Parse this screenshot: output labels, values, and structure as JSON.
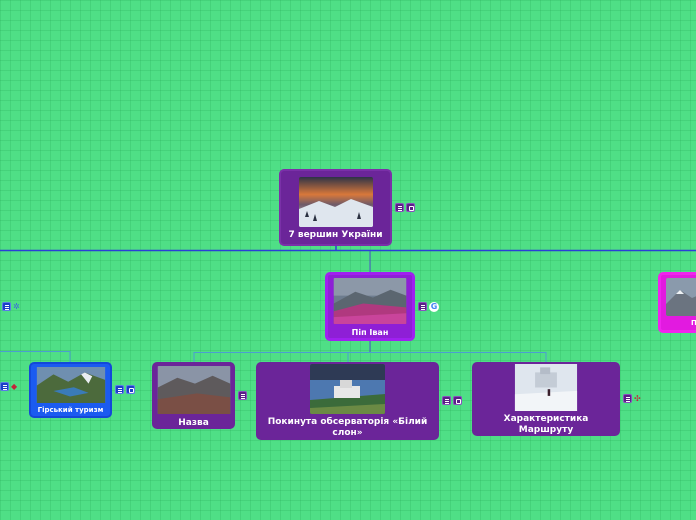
{
  "nodes": {
    "root": {
      "label": "7 вершин України"
    },
    "pip_ivan": {
      "label": "Піп Іван"
    },
    "girskyi_turyzm": {
      "label": "Гірський туризм"
    },
    "nazva": {
      "label": "Назва"
    },
    "observatoriya": {
      "label": "Покинута обсерваторія «Білий слон»"
    },
    "kharakterystyka": {
      "label": "Характеристика Маршруту"
    },
    "right_partial": {
      "label": "П"
    }
  },
  "colors": {
    "background": "#4fdf86",
    "link_main": "#2a3fd8",
    "node_purple": "#6b2599",
    "node_violet": "#8e1fd6",
    "node_blue": "#1b5bf0",
    "node_pink": "#e21ae0"
  },
  "icons": [
    "notes-icon",
    "link-icon",
    "google-icon",
    "pin-icon",
    "globe-icon"
  ]
}
